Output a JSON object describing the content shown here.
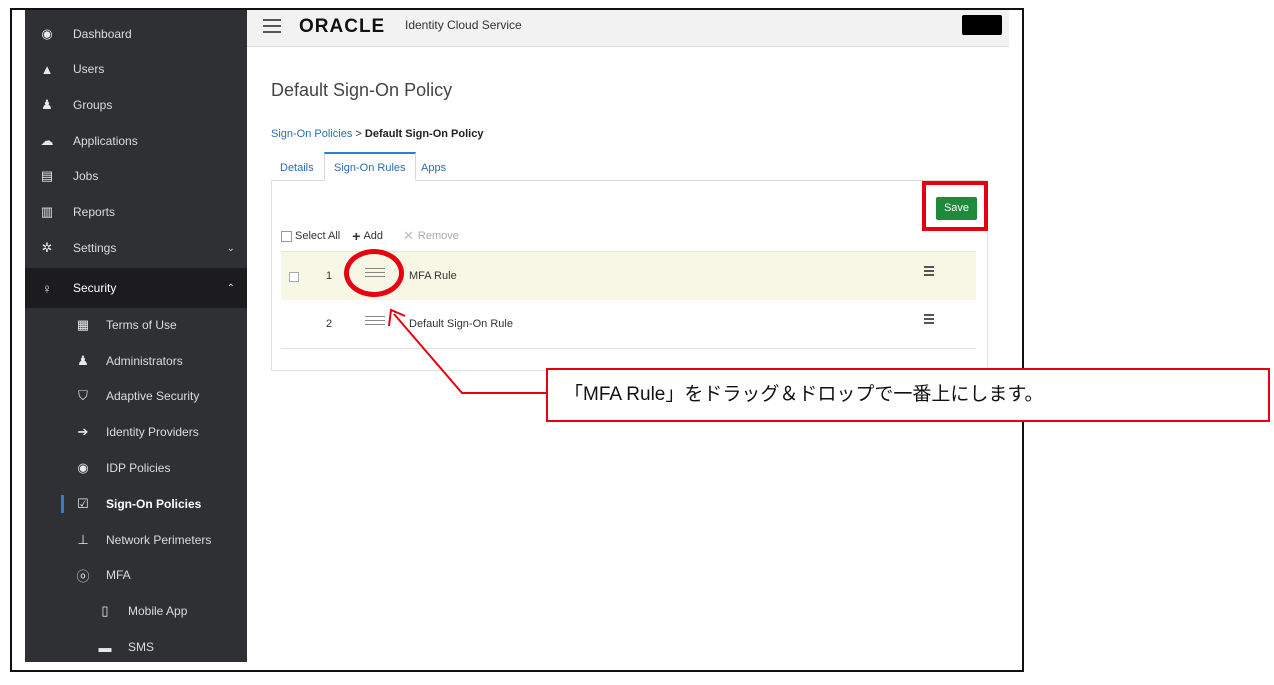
{
  "sidebar": {
    "items": [
      {
        "label": "Dashboard",
        "icon": "dashboard-icon",
        "glyph": "◉"
      },
      {
        "label": "Users",
        "icon": "user-icon",
        "glyph": "▲"
      },
      {
        "label": "Groups",
        "icon": "groups-icon",
        "glyph": "♟"
      },
      {
        "label": "Applications",
        "icon": "cloud-icon",
        "glyph": "☁"
      },
      {
        "label": "Jobs",
        "icon": "jobs-icon",
        "glyph": "▤"
      },
      {
        "label": "Reports",
        "icon": "bar-chart-icon",
        "glyph": "▥"
      },
      {
        "label": "Settings",
        "icon": "gear-icon",
        "glyph": "✲"
      },
      {
        "label": "Security",
        "icon": "key-icon",
        "glyph": "♀"
      }
    ],
    "security_sub": [
      {
        "label": "Terms of Use",
        "icon": "document-icon",
        "glyph": "▦"
      },
      {
        "label": "Administrators",
        "icon": "admin-icon",
        "glyph": "♟"
      },
      {
        "label": "Adaptive Security",
        "icon": "shield-icon",
        "glyph": "⛉"
      },
      {
        "label": "Identity Providers",
        "icon": "sign-in-icon",
        "glyph": "➔"
      },
      {
        "label": "IDP Policies",
        "icon": "policy-icon",
        "glyph": "◉"
      },
      {
        "label": "Sign-On Policies",
        "icon": "checklist-icon",
        "glyph": "☑"
      },
      {
        "label": "Network Perimeters",
        "icon": "network-icon",
        "glyph": "⊥"
      },
      {
        "label": "MFA",
        "icon": "mfa-icon",
        "glyph": "ⓞ"
      }
    ],
    "mfa_sub": [
      {
        "label": "Mobile App",
        "icon": "mobile-icon",
        "glyph": "▯"
      },
      {
        "label": "SMS",
        "icon": "sms-icon",
        "glyph": "▬"
      }
    ]
  },
  "header": {
    "logo": "ORACLE",
    "subtitle": "Identity Cloud Service"
  },
  "page": {
    "title": "Default Sign-On Policy",
    "breadcrumb_link": "Sign-On Policies",
    "breadcrumb_sep": ">",
    "breadcrumb_current": "Default Sign-On Policy",
    "tabs": [
      "Details",
      "Sign-On Rules",
      "Apps"
    ],
    "save_label": "Save",
    "select_all": "Select All",
    "add_label": "Add",
    "remove_label": "Remove",
    "rules": [
      {
        "num": "1",
        "name": "MFA Rule"
      },
      {
        "num": "2",
        "name": "Default Sign-On Rule"
      }
    ]
  },
  "annotation": {
    "text": "「MFA Rule」をドラッグ＆ドロップで一番上にします。",
    "color": "#e60012"
  }
}
